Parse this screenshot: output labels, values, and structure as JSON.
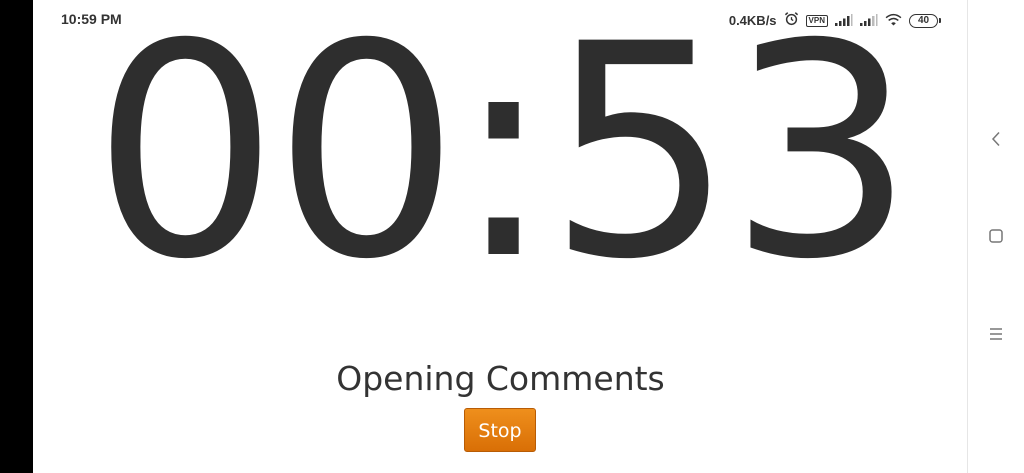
{
  "status_bar": {
    "time": "10:59 PM",
    "network_speed": "0.4KB/s",
    "vpn_label": "VPN",
    "battery_level": "40",
    "icons": [
      "alarm-icon",
      "vpn-icon",
      "signal-icon-1",
      "signal-icon-2",
      "wifi-icon",
      "battery-icon"
    ]
  },
  "timer": {
    "display": "00:53",
    "segment_label": "Opening Comments"
  },
  "controls": {
    "stop_label": "Stop",
    "stop_color": "#e17d0f"
  },
  "nav_bar": {
    "icons": [
      "back-icon",
      "home-icon",
      "recents-icon"
    ]
  },
  "colors": {
    "text": "#2e2e2e",
    "background": "#ffffff",
    "accent": "#e17d0f"
  }
}
